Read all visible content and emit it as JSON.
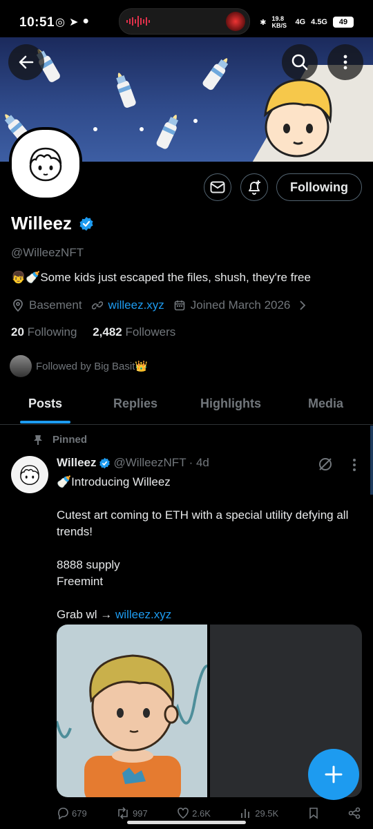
{
  "status_bar": {
    "time": "10:51",
    "speed": "19.8 KB/S",
    "net1": "4G",
    "net2": "4.5G",
    "battery": "49"
  },
  "profile": {
    "name": "Willeez",
    "handle": "@WilleezNFT",
    "bio": "👦🍼Some kids just escaped the files, shush, they're free",
    "location": "Basement",
    "website": "willeez.xyz",
    "joined": "Joined March 2026",
    "following_count": "20",
    "following_label": "Following",
    "followers_count": "2,482",
    "followers_label": "Followers",
    "followed_by": "Followed by Big Basit👑"
  },
  "actions": {
    "following_button": "Following"
  },
  "tabs": [
    {
      "label": "Posts",
      "active": true
    },
    {
      "label": "Replies"
    },
    {
      "label": "Highlights"
    },
    {
      "label": "Media"
    }
  ],
  "post": {
    "pinned_label": "Pinned",
    "author": "Willeez",
    "handle": "@WilleezNFT",
    "age": "· 4d",
    "line1": "🍼Introducing Willeez",
    "line2": "Cutest art coming to ETH with a special utility defying all trends!",
    "line3": "8888 supply",
    "line4": "Freemint",
    "line5_prefix": "Grab wl → ",
    "line5_link": "willeez.xyz",
    "stats": {
      "replies": "679",
      "reposts": "997",
      "likes": "2.6K",
      "views": "29.5K"
    }
  },
  "colors": {
    "accent": "#1d9bf0",
    "background": "#000000",
    "muted": "#71767b"
  }
}
